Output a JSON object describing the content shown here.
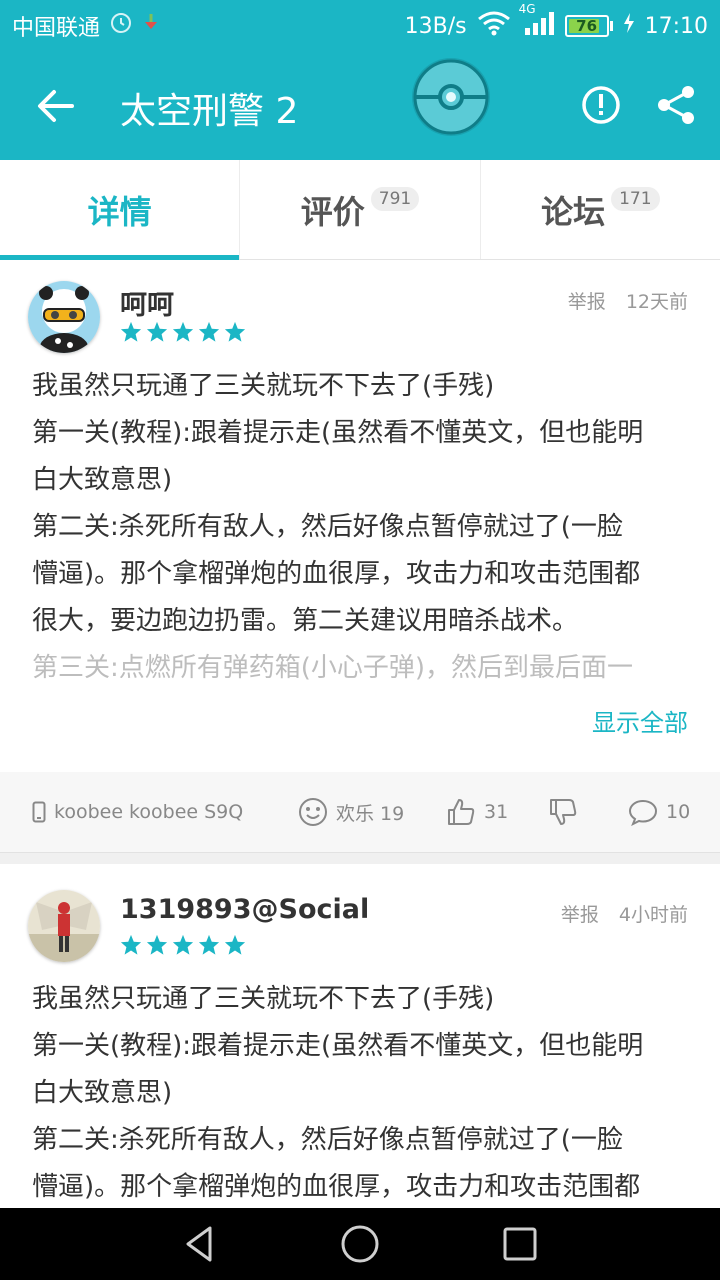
{
  "status_bar": {
    "carrier": "中国联通",
    "net_speed": "13B/s",
    "signal_label": "4G",
    "battery": "76",
    "time": "17:10"
  },
  "app_bar": {
    "title": "太空刑警 2"
  },
  "tabs": [
    {
      "label": "详情",
      "count": ""
    },
    {
      "label": "评价",
      "count": "791"
    },
    {
      "label": "论坛",
      "count": "171"
    }
  ],
  "reviews": [
    {
      "username": "呵呵",
      "report": "举报",
      "time": "12天前",
      "lines": [
        "我虽然只玩通了三关就玩不下去了(手残)",
        "第一关(教程):跟着提示走(虽然看不懂英文，但也能明",
        "白大致意思)",
        "第二关:杀死所有敌人，然后好像点暂停就过了(一脸",
        "懵逼)。那个拿榴弹炮的血很厚，攻击力和攻击范围都",
        "很大，要边跑边扔雷。第二关建议用暗杀战术。",
        "第三关:点燃所有弹药箱(小心子弹)，然后到最后面一"
      ],
      "show_all": "显示全部",
      "device": "koobee koobee S9Q",
      "mood": "欢乐 19",
      "likes": "31",
      "comments": "10"
    },
    {
      "username": "1319893@Social",
      "report": "举报",
      "time": "4小时前",
      "lines": [
        "我虽然只玩通了三关就玩不下去了(手残)",
        "第一关(教程):跟着提示走(虽然看不懂英文，但也能明",
        "白大致意思)",
        "第二关:杀死所有敌人，然后好像点暂停就过了(一脸",
        "懵逼)。那个拿榴弹炮的血很厚，攻击力和攻击范围都"
      ]
    }
  ],
  "colors": {
    "accent": "#1bb6c5",
    "star": "#1bb6c5"
  }
}
